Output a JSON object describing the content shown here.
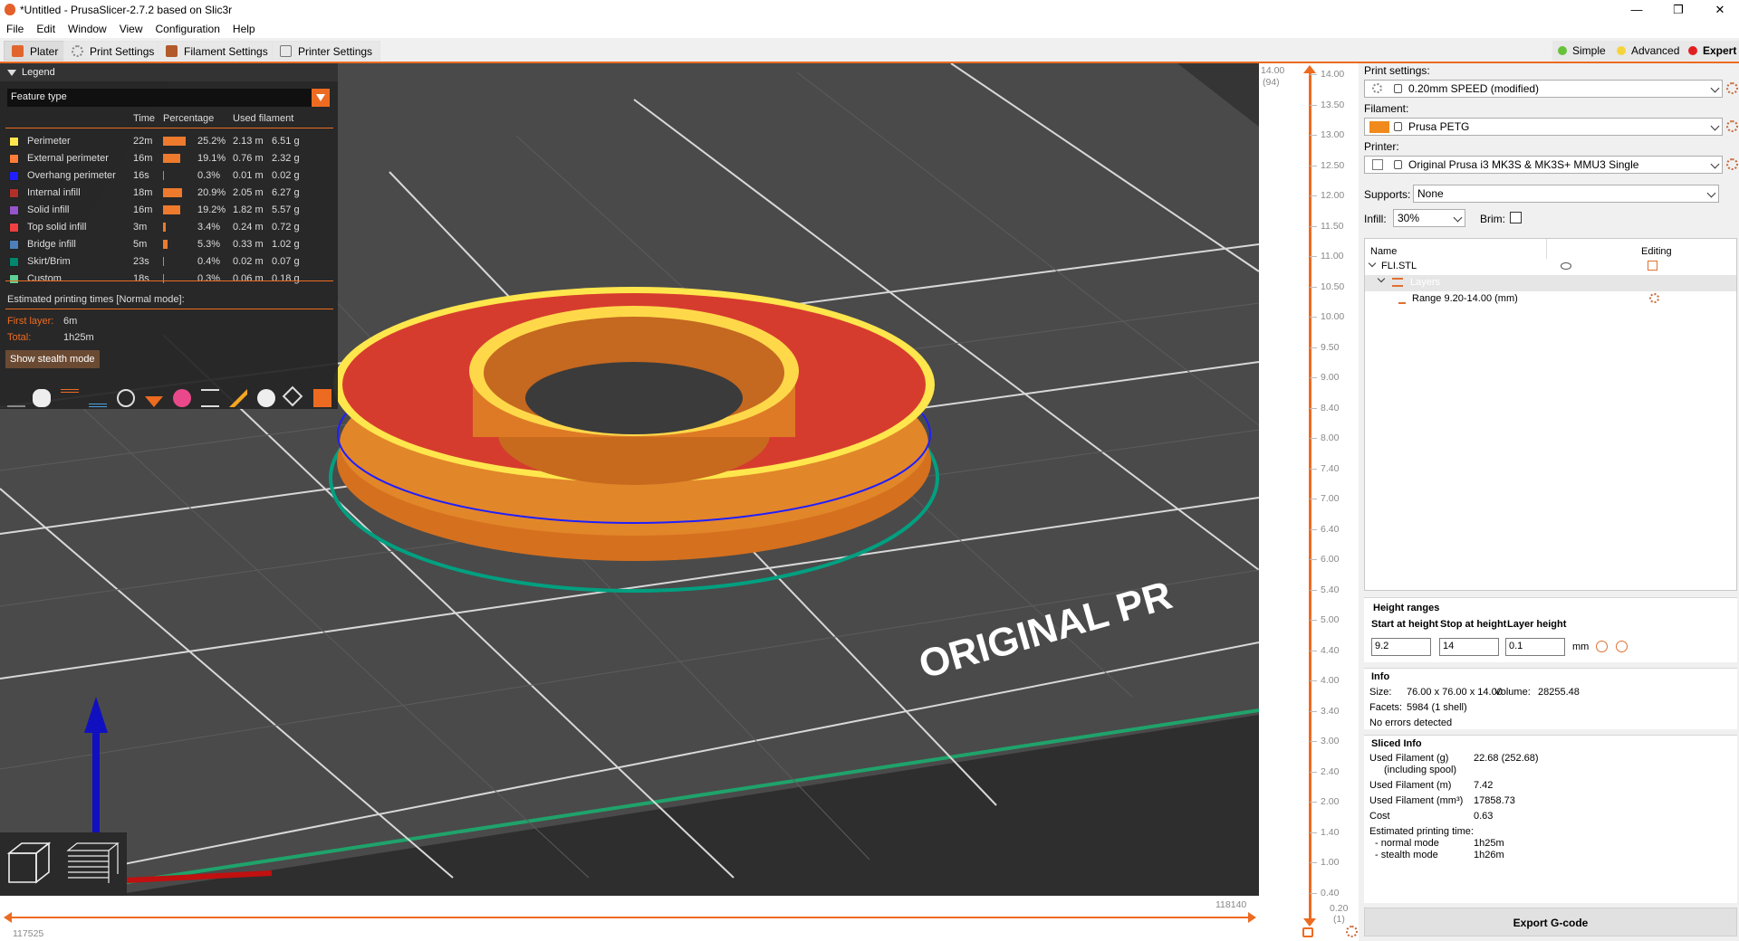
{
  "titlebar": {
    "title": "*Untitled - PrusaSlicer-2.7.2 based on Slic3r",
    "minimize": "—",
    "maximize": "❐",
    "close": "✕"
  },
  "menu": [
    "File",
    "Edit",
    "Window",
    "View",
    "Configuration",
    "Help"
  ],
  "tabs": {
    "plater": "Plater",
    "print": "Print Settings",
    "filament": "Filament Settings",
    "printer": "Printer Settings"
  },
  "modes": {
    "simple": "Simple",
    "advanced": "Advanced",
    "expert": "Expert"
  },
  "colors": {
    "accent": "#ed6b21",
    "simple": "#67c23a",
    "advanced": "#f5d43b",
    "expert": "#e02020"
  },
  "legend": {
    "title": "Legend",
    "view_type": "Feature type",
    "headers": {
      "time": "Time",
      "percentage": "Percentage",
      "used": "Used filament"
    },
    "rows": [
      {
        "name": "Perimeter",
        "color": "#ffe64d",
        "time": "22m",
        "pct": "25.2%",
        "pct_value": 25.2,
        "m": "2.13 m",
        "g": "6.51 g"
      },
      {
        "name": "External perimeter",
        "color": "#ff7d38",
        "time": "16m",
        "pct": "19.1%",
        "pct_value": 19.1,
        "m": "0.76 m",
        "g": "2.32 g"
      },
      {
        "name": "Overhang perimeter",
        "color": "#1f1fff",
        "time": "16s",
        "pct": "0.3%",
        "pct_value": 0.3,
        "m": "0.01 m",
        "g": "0.02 g"
      },
      {
        "name": "Internal infill",
        "color": "#b03029",
        "time": "18m",
        "pct": "20.9%",
        "pct_value": 20.9,
        "m": "2.05 m",
        "g": "6.27 g"
      },
      {
        "name": "Solid infill",
        "color": "#9654cc",
        "time": "16m",
        "pct": "19.2%",
        "pct_value": 19.2,
        "m": "1.82 m",
        "g": "5.57 g"
      },
      {
        "name": "Top solid infill",
        "color": "#f04040",
        "time": "3m",
        "pct": "3.4%",
        "pct_value": 3.4,
        "m": "0.24 m",
        "g": "0.72 g"
      },
      {
        "name": "Bridge infill",
        "color": "#4d80ba",
        "time": "5m",
        "pct": "5.3%",
        "pct_value": 5.3,
        "m": "0.33 m",
        "g": "1.02 g"
      },
      {
        "name": "Skirt/Brim",
        "color": "#00876e",
        "time": "23s",
        "pct": "0.4%",
        "pct_value": 0.4,
        "m": "0.02 m",
        "g": "0.07 g"
      },
      {
        "name": "Custom",
        "color": "#5ed194",
        "time": "18s",
        "pct": "0.3%",
        "pct_value": 0.3,
        "m": "0.06 m",
        "g": "0.18 g"
      }
    ],
    "est_label": "Estimated printing times [Normal mode]:",
    "first_layer_label": "First layer:",
    "first_layer": "6m",
    "total_label": "Total:",
    "total": "1h25m",
    "stealth_button": "Show stealth mode"
  },
  "bed": {
    "text": "ORIGINAL PR"
  },
  "height_slider": {
    "top_value": "14.00",
    "top_layer": "(94)",
    "bottom_value": "0.20",
    "bottom_layer": "(1)",
    "ticks": [
      "14.00",
      "13.50",
      "13.00",
      "12.50",
      "12.00",
      "11.50",
      "11.00",
      "10.50",
      "10.00",
      "9.50",
      "9.00",
      "8.40",
      "8.00",
      "7.40",
      "7.00",
      "6.40",
      "6.00",
      "5.40",
      "5.00",
      "4.40",
      "4.00",
      "3.40",
      "3.00",
      "2.40",
      "2.00",
      "1.40",
      "1.00",
      "0.40"
    ]
  },
  "horiz_slider": {
    "left": "117525",
    "right": "118140"
  },
  "sidebar": {
    "print_label": "Print settings:",
    "print_value": "0.20mm SPEED (modified)",
    "filament_label": "Filament:",
    "filament_value": "Prusa PETG",
    "filament_color": "#f18a1c",
    "printer_label": "Printer:",
    "printer_value": "Original Prusa i3 MK3S & MK3S+ MMU3 Single",
    "supports_label": "Supports:",
    "supports_value": "None",
    "infill_label": "Infill:",
    "infill_value": "30%",
    "brim_label": "Brim:",
    "list_name_header": "Name",
    "list_editing_header": "Editing",
    "object_name": "FLI.STL",
    "layers_label": "Layers",
    "range_label": "Range 9.20-14.00 (mm)",
    "height_ranges_title": "Height ranges",
    "start_label": "Start at height",
    "stop_label": "Stop at height",
    "layer_label": "Layer height",
    "start_value": "9.2",
    "stop_value": "14",
    "layer_value": "0.1",
    "unit": "mm",
    "info_title": "Info",
    "size_label": "Size:",
    "size_value": "76.00 x 76.00 x 14.00",
    "volume_label": "Volume:",
    "volume_value": "28255.48",
    "facets_label": "Facets:",
    "facets_value": "5984 (1 shell)",
    "errors": "No errors detected",
    "sliced_title": "Sliced Info",
    "used_g_label": "Used Filament (g)",
    "used_g_sub": "(including spool)",
    "used_g_value": "22.68 (252.68)",
    "used_m_label": "Used Filament (m)",
    "used_m_value": "7.42",
    "used_mm3_label": "Used Filament (mm³)",
    "used_mm3_value": "17858.73",
    "cost_label": "Cost",
    "cost_value": "0.63",
    "est_label": "Estimated printing time:",
    "normal_label": "- normal mode",
    "normal_value": "1h25m",
    "stealth_label": "- stealth mode",
    "stealth_value": "1h26m",
    "export_button": "Export G-code"
  }
}
